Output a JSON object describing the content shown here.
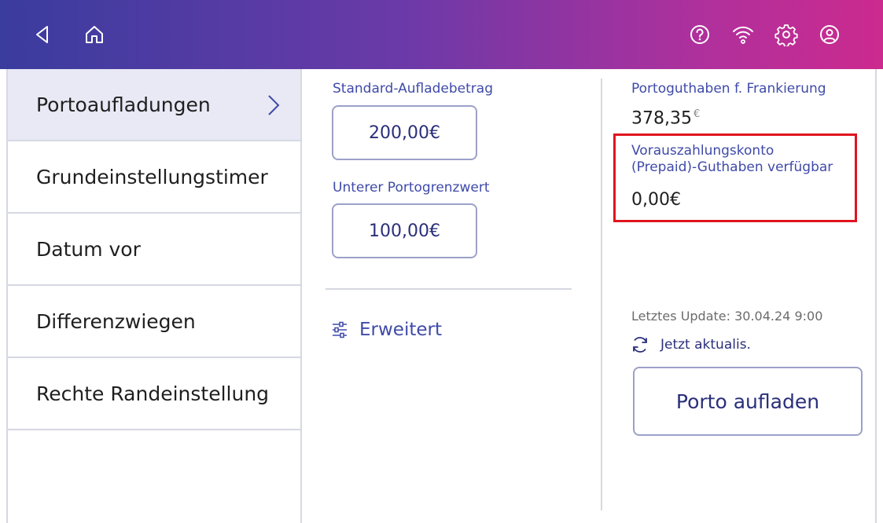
{
  "icons": {
    "back": "back-triangle-icon",
    "home": "home-icon",
    "help": "help-circle-icon",
    "wifi": "wifi-icon",
    "settings": "gear-icon",
    "account": "account-icon",
    "chevron": "chevron-right-icon",
    "advanced": "sliders-icon",
    "refresh": "refresh-icon"
  },
  "colors": {
    "header_gradient_start": "#3a3c9e",
    "header_gradient_end": "#cc2a8e",
    "accent_text": "#3f4aa8",
    "highlight_border": "#e0141e",
    "active_item_bg": "#e8e9f5"
  },
  "sidebar": {
    "items": [
      {
        "label": "Portoaufladungen",
        "active": true
      },
      {
        "label": "Grundeinstellungstimer"
      },
      {
        "label": "Datum vor"
      },
      {
        "label": "Differenzwiegen"
      },
      {
        "label": "Rechte Randeinstellung"
      }
    ]
  },
  "settings": {
    "standard_label": "Standard-Aufladebetrag",
    "standard_value": "200,00€",
    "lower_label": "Unterer Portogrenzwert",
    "lower_value": "100,00€",
    "advanced_label": "Erweitert"
  },
  "account": {
    "postage_label": "Portoguthaben f. Frankierung",
    "postage_value": "378,35",
    "postage_currency": "€",
    "prepaid_label_line1": "Vorauszahlungskonto",
    "prepaid_label_line2": "(Prepaid)-Guthaben verfügbar",
    "prepaid_value": "0,00€",
    "last_update": "Letztes Update: 30.04.24 9:00",
    "refresh_label": "Jetzt aktualis.",
    "refill_button": "Porto aufladen"
  }
}
